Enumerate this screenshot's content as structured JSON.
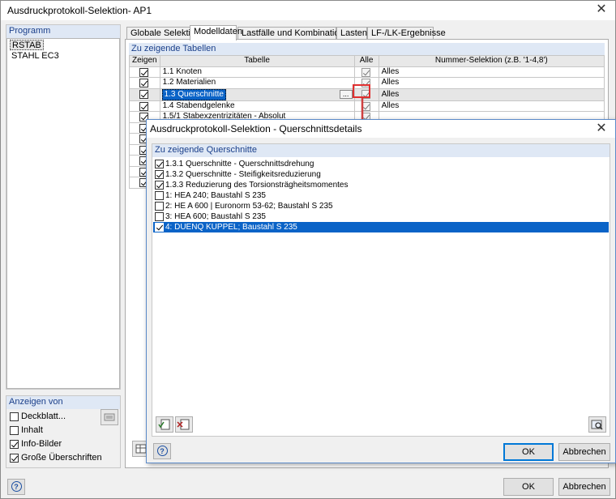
{
  "window": {
    "title": "Ausdruckprotokoll-Selektion- AP1"
  },
  "program": {
    "title": "Programm",
    "items": [
      "RSTAB",
      "STAHL EC3"
    ]
  },
  "show_from": {
    "title": "Anzeigen von",
    "items": [
      {
        "label": "Deckblatt...",
        "checked": false
      },
      {
        "label": "Inhalt",
        "checked": false
      },
      {
        "label": "Info-Bilder",
        "checked": true
      },
      {
        "label": "Große Überschriften",
        "checked": true
      }
    ]
  },
  "tabs": [
    "Globale Selektion",
    "Modelldaten",
    "Lastfälle und Kombinationen",
    "Lasten",
    "LF-/LK-Ergebnisse"
  ],
  "active_tab": "Modelldaten",
  "tables_group": {
    "title": "Zu zeigende Tabellen"
  },
  "table": {
    "headers": [
      "Zeigen",
      "Tabelle",
      "Alle",
      "Nummer-Selektion (z.B. '1-4,8')"
    ],
    "rows": [
      {
        "table": "1.1 Knoten",
        "selection": "Alles"
      },
      {
        "table": "1.2 Materialien",
        "selection": "Alles"
      },
      {
        "table": "1.3 Querschnitte",
        "selection": "Alles",
        "button": "..."
      },
      {
        "table": "1.4 Stabendgelenke",
        "selection": "Alles"
      },
      {
        "table": "1.5/1 Stabexzentrizitäten - Absolut",
        "selection": ""
      }
    ]
  },
  "footer": {
    "ok": "OK",
    "cancel": "Abbrechen"
  },
  "dialog": {
    "title": "Ausdruckprotokoll-Selektion - Querschnittsdetails",
    "group_title": "Zu zeigende Querschnitte",
    "items": [
      {
        "label": "1.3.1 Querschnitte  - Querschnittsdrehung",
        "checked": true
      },
      {
        "label": "1.3.2 Querschnitte  - Steifigkeitsreduzierung",
        "checked": true
      },
      {
        "label": "1.3.3 Reduzierung des Torsionsträgheitsmomentes",
        "checked": true
      },
      {
        "label": "1: HEA 240; Baustahl S 235",
        "checked": false
      },
      {
        "label": "2: HE A 600 | Euronorm 53-62; Baustahl S 235",
        "checked": false
      },
      {
        "label": "3: HEA 600; Baustahl S 235",
        "checked": false
      },
      {
        "label": "4: DUENQ KUPPEL; Baustahl S 235",
        "checked": true,
        "selected": true
      }
    ],
    "ok": "OK",
    "cancel": "Abbrechen"
  },
  "colors": {
    "accent": "#0a63c7",
    "highlight_box": "#e03030",
    "group_header_bg": "#dfe8f5"
  }
}
